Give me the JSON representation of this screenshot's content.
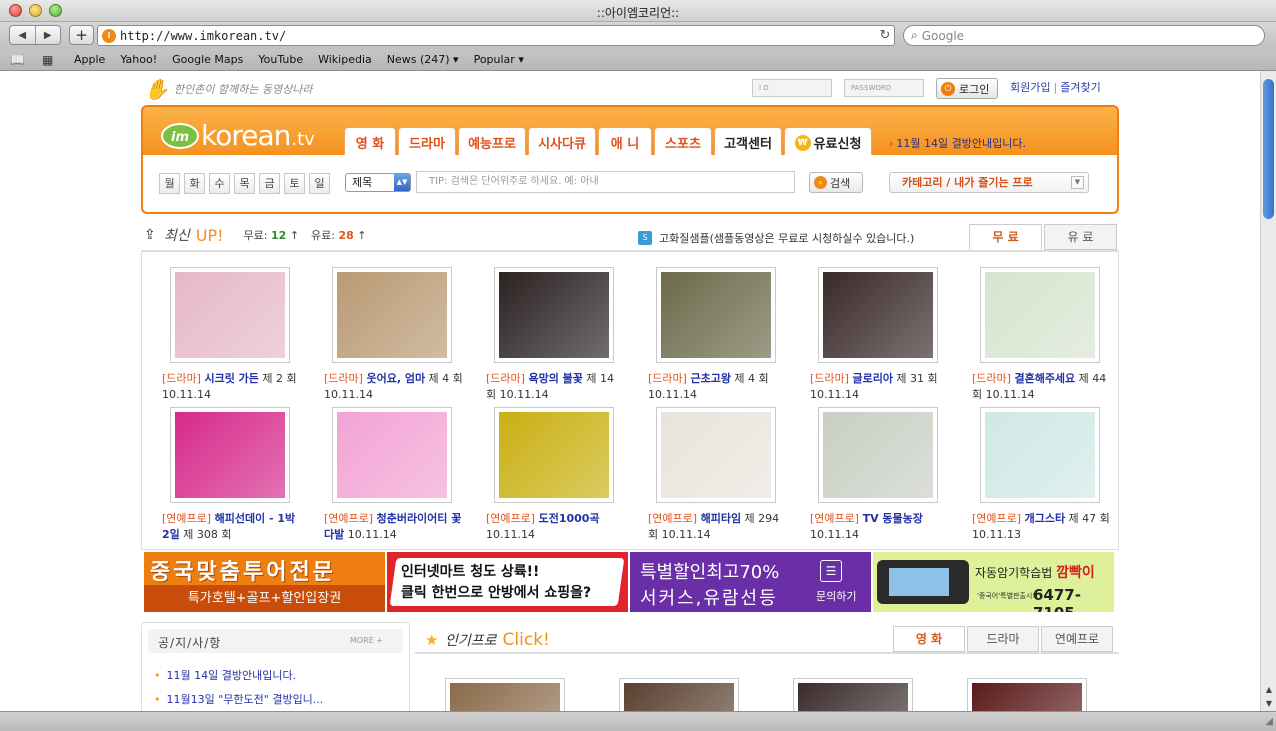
{
  "browser": {
    "window_title": "::아이엠코리언::",
    "url": "http://www.imkorean.tv/",
    "search_placeholder": "Google",
    "bookmarks": [
      "Apple",
      "Yahoo!",
      "Google Maps",
      "YouTube",
      "Wikipedia",
      "News (247) ▾",
      "Popular ▾"
    ]
  },
  "site": {
    "slogan": "한인촌이 함께하는 동영상나라",
    "login": {
      "id_placeholder": "I D",
      "pw_placeholder": "PASSWORD",
      "button": "로그인"
    },
    "top_links": [
      "회원가입",
      "즐겨찾기"
    ],
    "logo": {
      "badge": "im",
      "text": "korean",
      "suffix": ".tv"
    },
    "nav_tabs": [
      {
        "label": "영 화",
        "width": 52
      },
      {
        "label": "드라마",
        "width": 58
      },
      {
        "label": "예능프로",
        "width": 68
      },
      {
        "label": "시사다큐",
        "width": 68
      },
      {
        "label": "애 니",
        "width": 54
      },
      {
        "label": "스포츠",
        "width": 58
      },
      {
        "label": "고객센터",
        "width": 68
      },
      {
        "label": "유료신청",
        "width": 88
      }
    ],
    "notice_link": "11월 14일 결방안내입니다.",
    "days": [
      "월",
      "화",
      "수",
      "목",
      "금",
      "토",
      "일"
    ],
    "search": {
      "select_value": "제목",
      "input_placeholder": "TIP: 검색은 단어위주로 하세요. 예: 아내",
      "button": "검색",
      "category_button": "카테고리 / 내가 즐기는 프로"
    }
  },
  "latest": {
    "label": "최신",
    "title": "UP!",
    "free_label": "무료:",
    "free_count": "12",
    "paid_label": "유료:",
    "paid_count": "28",
    "arrow": "↑",
    "hd_note": "고화질샘플(샘플동영상은 무료로 시청하실수 있습니다.)",
    "tabs": [
      "무 료",
      "유 료"
    ],
    "shows": [
      {
        "cat": "[드라마]",
        "title": "시크릿 가든",
        "ep": " 제 2 회 10.11.14",
        "color": "#e6b8c9"
      },
      {
        "cat": "[드라마]",
        "title": "웃어요, 엄마",
        "ep": " 제 4 회 10.11.14",
        "color": "#b99a74"
      },
      {
        "cat": "[드라마]",
        "title": "욕망의 불꽃",
        "ep": " 제 14 회 10.11.14",
        "color": "#2b2222"
      },
      {
        "cat": "[드라마]",
        "title": "근초고왕",
        "ep": " 제 4 회 10.11.14",
        "color": "#6c6a4a"
      },
      {
        "cat": "[드라마]",
        "title": "글로리아",
        "ep": " 제 31 회 10.11.14",
        "color": "#3a2a2a"
      },
      {
        "cat": "[드라마]",
        "title": "결혼해주세요",
        "ep": " 제 44 회 10.11.14",
        "color": "#d7e4cf"
      },
      {
        "cat": "[연예프로]",
        "title": "해피선데이 - 1박2일",
        "ep": " 제 308 회",
        "color": "#d62a8c"
      },
      {
        "cat": "[연예프로]",
        "title": "청춘버라이어티 꽃다발",
        "ep": " 10.11.14",
        "color": "#f2a3d4"
      },
      {
        "cat": "[연예프로]",
        "title": "도전1000곡",
        "ep": " 10.11.14",
        "color": "#c9b012"
      },
      {
        "cat": "[연예프로]",
        "title": "해피타임",
        "ep": " 제 294 회 10.11.14",
        "color": "#e8e4dc"
      },
      {
        "cat": "[연예프로]",
        "title": "TV 동물농장",
        "ep": " 10.11.14",
        "color": "#c9cfc4"
      },
      {
        "cat": "[연예프로]",
        "title": "개그스타",
        "ep": " 제 47 회 10.11.13",
        "color": "#cfe8e6"
      }
    ]
  },
  "banners": {
    "b1": {
      "line1": "중국맞춤투어전문",
      "line2": "특가호텔+골프+할인입장권"
    },
    "b2": {
      "line1": "인터넷마트 청도 상륙!!",
      "line2": "클릭 한번으로 안방에서 쇼핑을?"
    },
    "b3": {
      "line1": "특별할인최고70%",
      "line2": "서커스,유람선등",
      "cta": "문의하기"
    },
    "b4": {
      "line1": "자동암기학습법",
      "brand": "깜빡이",
      "line2": "'중국어'특별판출시!!",
      "phone": "6477-7105"
    }
  },
  "notice": {
    "title": "공/지/사/항",
    "more": "MORE +",
    "items": [
      "11월 14일 결방안내입니다.",
      "11월13일 \"무한도전\" 결방입니..."
    ]
  },
  "popular": {
    "label": "인기프로",
    "title": "Click!",
    "tabs": [
      "영 화",
      "드라마",
      "연예프로"
    ],
    "items": [
      {
        "color": "#8a6a4a"
      },
      {
        "color": "#5a4030"
      },
      {
        "color": "#3b2c2c"
      },
      {
        "color": "#5a1a1a"
      }
    ]
  }
}
